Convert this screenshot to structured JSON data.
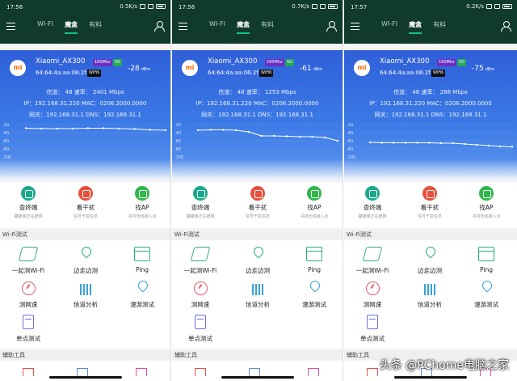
{
  "colors": {
    "header_bg": "#0f3a2d",
    "tab_accent": "#17c08a",
    "card_top": "#2f5fd8",
    "card_bottom": "#5b94ee",
    "line": "#ffffff"
  },
  "topbar": {
    "tabs": [
      "WI-FI",
      "魔盒",
      "有料"
    ],
    "active_tab": 1
  },
  "quick_actions": [
    {
      "label": "查终端",
      "sub": "瞄瞄谁正在蹭网",
      "icon": "scan-devices-icon"
    },
    {
      "label": "看干扰",
      "sub": "信号干扰信息",
      "icon": "interference-icon"
    },
    {
      "label": "找AP",
      "sub": "寻找无线接入点",
      "icon": "router-icon"
    }
  ],
  "section_wifi_test": "Wi-Fi测试",
  "section_tools": "辅助工具",
  "tools": [
    {
      "label": "一起测Wi-Fi",
      "icon": "handshake-icon"
    },
    {
      "label": "边走边测",
      "icon": "location-pin-icon"
    },
    {
      "label": "Ping",
      "icon": "ping-icon"
    },
    {
      "label": "测网速",
      "icon": "speed-gauge-icon"
    },
    {
      "label": "信道分析",
      "icon": "channel-bars-icon"
    },
    {
      "label": "漫游测试",
      "icon": "roaming-pin-icon"
    },
    {
      "label": "单点测试",
      "icon": "document-icon"
    }
  ],
  "screens": [
    {
      "status_time": "17:56",
      "status_speed": "0.5K/s",
      "ssid": "Xiaomi_AX300",
      "bandwidth_badge": "160Mhz",
      "band_badge": "5G",
      "mac": "64:64:4a:aa:06:2f",
      "wifi_badge": "WiFi6",
      "signal_value": "-28",
      "signal_unit": "dBm",
      "channel_line": "信道： 48    速率： 2401 Mbps",
      "ip_line": "IP：192.168.31.220   MAC：0206.2000.0000",
      "gateway_line": "网关：192.168.31.1    DNS：192.168.31.1",
      "y_ticks": [
        "-20",
        "-40",
        "-60",
        "-80",
        "-100"
      ],
      "chart_data": {
        "type": "line",
        "ylim": [
          -100,
          -20
        ],
        "values": [
          -29,
          -30,
          -30,
          -30,
          -29,
          -29,
          -30,
          -31,
          -33,
          -34
        ]
      }
    },
    {
      "status_time": "17:56",
      "status_speed": "0.7K/s",
      "ssid": "Xiaomi_AX300",
      "bandwidth_badge": "160Mhz",
      "band_badge": "5G",
      "mac": "64:64:4a:aa:06:2f",
      "wifi_badge": "WiFi6",
      "signal_value": "-61",
      "signal_unit": "dBm",
      "channel_line": "信道： 48    速率： 1253 Mbps",
      "ip_line": "IP：192.168.31.220   MAC：0206.2000.0000",
      "gateway_line": "网关：192.168.31.1    DNS：192.168.31.1",
      "y_ticks": [
        "-20",
        "-40",
        "-60",
        "-80",
        "-100"
      ],
      "chart_data": {
        "type": "line",
        "ylim": [
          -100,
          -20
        ],
        "values": [
          -34,
          -33,
          -33,
          -34,
          -38,
          -48,
          -48,
          -49,
          -50,
          -50,
          -52,
          -60
        ]
      }
    },
    {
      "status_time": "17:57",
      "status_speed": "0.2K/s",
      "ssid": "Xiaomi_AX300",
      "bandwidth_badge": "160Mhz",
      "band_badge": "5G",
      "mac": "64:64:4a:aa:06:2f",
      "wifi_badge": "WiFi6",
      "signal_value": "-75",
      "signal_unit": "dBm",
      "channel_line": "信道： 48    速率： 288 Mbps",
      "ip_line": "IP：192.168.31.220   MAC：0206.2000.0000",
      "gateway_line": "网关：192.168.31.1    DNS：192.168.31.1",
      "y_ticks": [
        "-20",
        "-40",
        "-60",
        "-80",
        "-100"
      ],
      "chart_data": {
        "type": "line",
        "ylim": [
          -100,
          -20
        ],
        "values": [
          -64,
          -65,
          -65,
          -65,
          -65,
          -65,
          -66,
          -66,
          -68,
          -70,
          -72,
          -74,
          -75
        ]
      }
    }
  ],
  "watermark": "头条 @PChome电脑之家"
}
